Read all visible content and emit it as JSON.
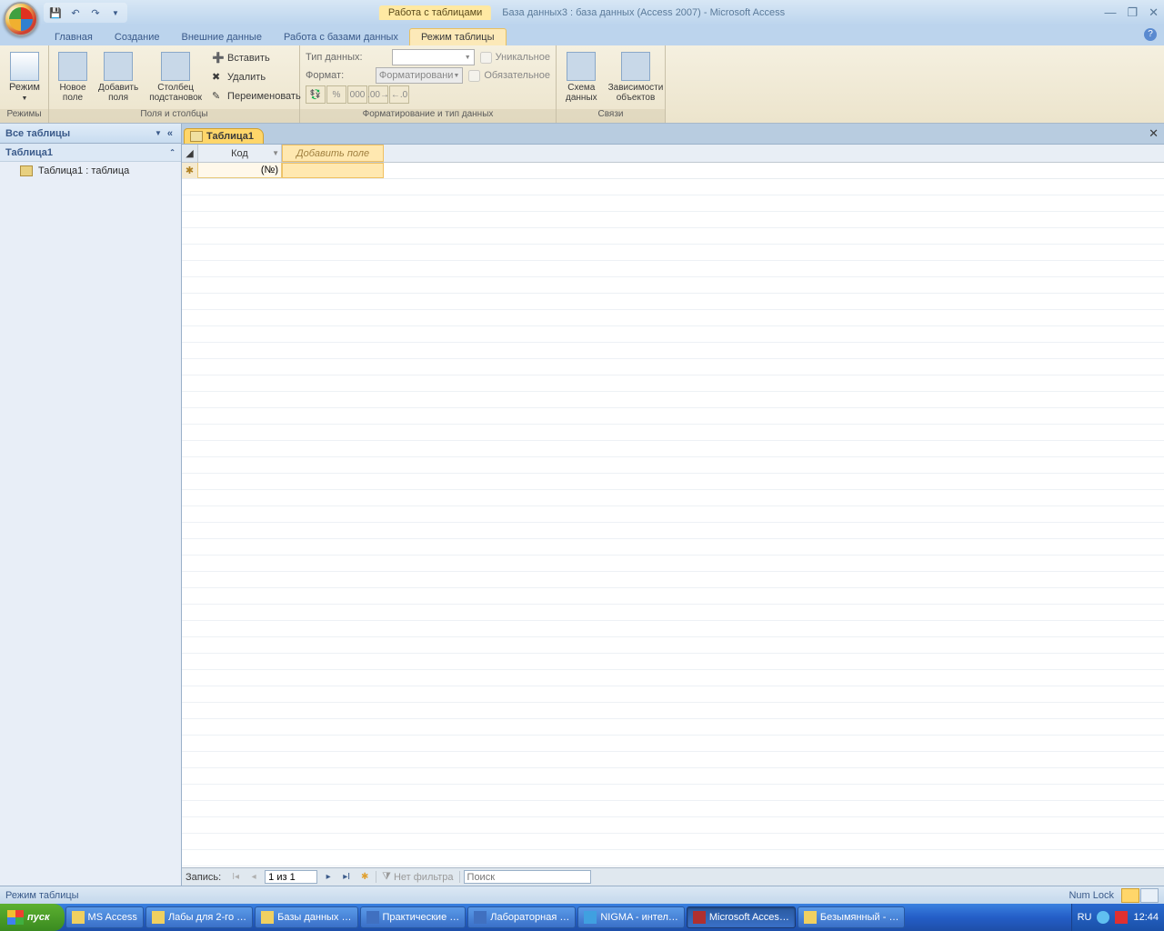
{
  "titlebar": {
    "contextual_label": "Работа с таблицами",
    "title": "База данных3 : база данных (Access 2007) - Microsoft Access"
  },
  "ribbon_tabs": {
    "home": "Главная",
    "create": "Создание",
    "external": "Внешние данные",
    "dbtools": "Работа с базами данных",
    "datasheet": "Режим таблицы"
  },
  "ribbon": {
    "views": {
      "mode": "Режим",
      "group": "Режимы"
    },
    "fields": {
      "new_field": "Новое\nполе",
      "add_fields": "Добавить\nполя",
      "lookup": "Столбец\nподстановок",
      "insert": "Вставить",
      "delete": "Удалить",
      "rename": "Переименовать",
      "group": "Поля и столбцы"
    },
    "format": {
      "datatype_lbl": "Тип данных:",
      "format_lbl": "Формат:",
      "format_placeholder": "Форматировани",
      "unique": "Уникальное",
      "required": "Обязательное",
      "group": "Форматирование и тип данных"
    },
    "relations": {
      "schema": "Схема\nданных",
      "deps": "Зависимости\nобъектов",
      "group": "Связи"
    }
  },
  "navpane": {
    "header": "Все таблицы",
    "group1": "Таблица1",
    "item1": "Таблица1 : таблица"
  },
  "document": {
    "tab": "Таблица1",
    "col_code": "Код",
    "col_add": "Добавить поле",
    "new_id": "(№)"
  },
  "recnav": {
    "label": "Запись:",
    "pos": "1 из 1",
    "nofilter": "Нет фильтра",
    "search": "Поиск"
  },
  "statusbar": {
    "mode": "Режим таблицы",
    "numlock": "Num Lock"
  },
  "taskbar": {
    "start": "пуск",
    "items": [
      "MS Access",
      "Лабы для 2-го …",
      "Базы данных …",
      "Практические …",
      "Лабораторная …",
      "NIGMA - интел…",
      "Microsoft Acces…",
      "Безымянный - …"
    ],
    "lang": "RU",
    "clock": "12:44"
  }
}
